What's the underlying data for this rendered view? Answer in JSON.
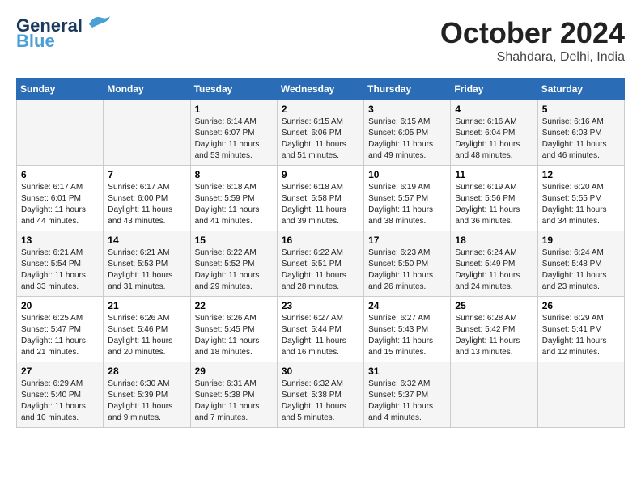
{
  "header": {
    "logo_line1": "General",
    "logo_line2": "Blue",
    "month": "October 2024",
    "location": "Shahdara, Delhi, India"
  },
  "weekdays": [
    "Sunday",
    "Monday",
    "Tuesday",
    "Wednesday",
    "Thursday",
    "Friday",
    "Saturday"
  ],
  "weeks": [
    [
      {
        "day": "",
        "info": ""
      },
      {
        "day": "",
        "info": ""
      },
      {
        "day": "1",
        "info": "Sunrise: 6:14 AM\nSunset: 6:07 PM\nDaylight: 11 hours and 53 minutes."
      },
      {
        "day": "2",
        "info": "Sunrise: 6:15 AM\nSunset: 6:06 PM\nDaylight: 11 hours and 51 minutes."
      },
      {
        "day": "3",
        "info": "Sunrise: 6:15 AM\nSunset: 6:05 PM\nDaylight: 11 hours and 49 minutes."
      },
      {
        "day": "4",
        "info": "Sunrise: 6:16 AM\nSunset: 6:04 PM\nDaylight: 11 hours and 48 minutes."
      },
      {
        "day": "5",
        "info": "Sunrise: 6:16 AM\nSunset: 6:03 PM\nDaylight: 11 hours and 46 minutes."
      }
    ],
    [
      {
        "day": "6",
        "info": "Sunrise: 6:17 AM\nSunset: 6:01 PM\nDaylight: 11 hours and 44 minutes."
      },
      {
        "day": "7",
        "info": "Sunrise: 6:17 AM\nSunset: 6:00 PM\nDaylight: 11 hours and 43 minutes."
      },
      {
        "day": "8",
        "info": "Sunrise: 6:18 AM\nSunset: 5:59 PM\nDaylight: 11 hours and 41 minutes."
      },
      {
        "day": "9",
        "info": "Sunrise: 6:18 AM\nSunset: 5:58 PM\nDaylight: 11 hours and 39 minutes."
      },
      {
        "day": "10",
        "info": "Sunrise: 6:19 AM\nSunset: 5:57 PM\nDaylight: 11 hours and 38 minutes."
      },
      {
        "day": "11",
        "info": "Sunrise: 6:19 AM\nSunset: 5:56 PM\nDaylight: 11 hours and 36 minutes."
      },
      {
        "day": "12",
        "info": "Sunrise: 6:20 AM\nSunset: 5:55 PM\nDaylight: 11 hours and 34 minutes."
      }
    ],
    [
      {
        "day": "13",
        "info": "Sunrise: 6:21 AM\nSunset: 5:54 PM\nDaylight: 11 hours and 33 minutes."
      },
      {
        "day": "14",
        "info": "Sunrise: 6:21 AM\nSunset: 5:53 PM\nDaylight: 11 hours and 31 minutes."
      },
      {
        "day": "15",
        "info": "Sunrise: 6:22 AM\nSunset: 5:52 PM\nDaylight: 11 hours and 29 minutes."
      },
      {
        "day": "16",
        "info": "Sunrise: 6:22 AM\nSunset: 5:51 PM\nDaylight: 11 hours and 28 minutes."
      },
      {
        "day": "17",
        "info": "Sunrise: 6:23 AM\nSunset: 5:50 PM\nDaylight: 11 hours and 26 minutes."
      },
      {
        "day": "18",
        "info": "Sunrise: 6:24 AM\nSunset: 5:49 PM\nDaylight: 11 hours and 24 minutes."
      },
      {
        "day": "19",
        "info": "Sunrise: 6:24 AM\nSunset: 5:48 PM\nDaylight: 11 hours and 23 minutes."
      }
    ],
    [
      {
        "day": "20",
        "info": "Sunrise: 6:25 AM\nSunset: 5:47 PM\nDaylight: 11 hours and 21 minutes."
      },
      {
        "day": "21",
        "info": "Sunrise: 6:26 AM\nSunset: 5:46 PM\nDaylight: 11 hours and 20 minutes."
      },
      {
        "day": "22",
        "info": "Sunrise: 6:26 AM\nSunset: 5:45 PM\nDaylight: 11 hours and 18 minutes."
      },
      {
        "day": "23",
        "info": "Sunrise: 6:27 AM\nSunset: 5:44 PM\nDaylight: 11 hours and 16 minutes."
      },
      {
        "day": "24",
        "info": "Sunrise: 6:27 AM\nSunset: 5:43 PM\nDaylight: 11 hours and 15 minutes."
      },
      {
        "day": "25",
        "info": "Sunrise: 6:28 AM\nSunset: 5:42 PM\nDaylight: 11 hours and 13 minutes."
      },
      {
        "day": "26",
        "info": "Sunrise: 6:29 AM\nSunset: 5:41 PM\nDaylight: 11 hours and 12 minutes."
      }
    ],
    [
      {
        "day": "27",
        "info": "Sunrise: 6:29 AM\nSunset: 5:40 PM\nDaylight: 11 hours and 10 minutes."
      },
      {
        "day": "28",
        "info": "Sunrise: 6:30 AM\nSunset: 5:39 PM\nDaylight: 11 hours and 9 minutes."
      },
      {
        "day": "29",
        "info": "Sunrise: 6:31 AM\nSunset: 5:38 PM\nDaylight: 11 hours and 7 minutes."
      },
      {
        "day": "30",
        "info": "Sunrise: 6:32 AM\nSunset: 5:38 PM\nDaylight: 11 hours and 5 minutes."
      },
      {
        "day": "31",
        "info": "Sunrise: 6:32 AM\nSunset: 5:37 PM\nDaylight: 11 hours and 4 minutes."
      },
      {
        "day": "",
        "info": ""
      },
      {
        "day": "",
        "info": ""
      }
    ]
  ]
}
